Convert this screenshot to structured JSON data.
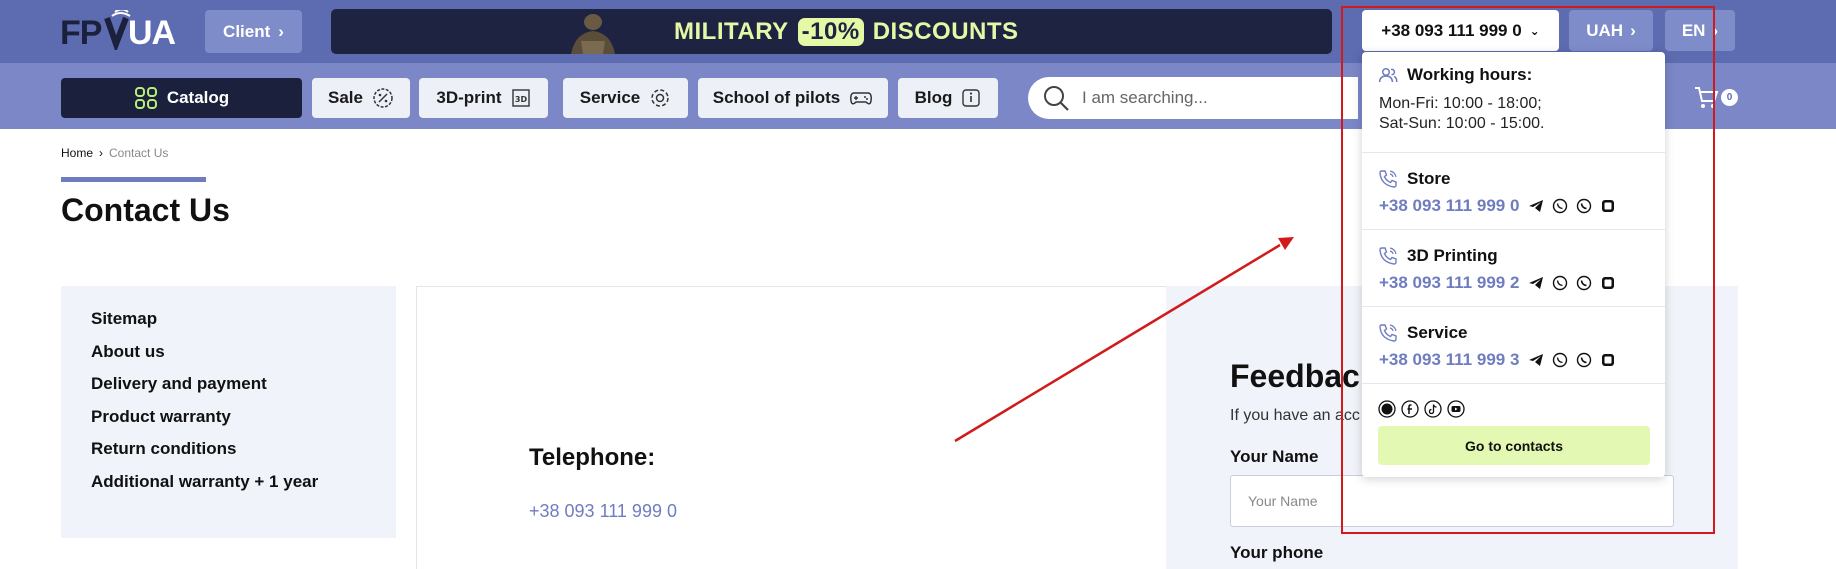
{
  "header": {
    "logo_text": "FPVUA",
    "client_label": "Client",
    "promo": {
      "word1": "MILITARY",
      "badge": "-10%",
      "word2": "DISCOUNTS"
    },
    "phone": "+38 093 111 999 0",
    "currency": "UAH",
    "language": "EN"
  },
  "nav": {
    "catalog": "Catalog",
    "items": [
      "Sale",
      "3D-print",
      "Service",
      "School of pilots",
      "Blog"
    ],
    "search_placeholder": "I am searching...",
    "cart_count": "0"
  },
  "breadcrumb": {
    "home": "Home",
    "separator": "›",
    "current": "Contact Us"
  },
  "page": {
    "title": "Contact Us"
  },
  "sidebar": {
    "items": [
      "Sitemap",
      "About us",
      "Delivery and payment",
      "Product warranty",
      "Return conditions",
      "Additional warranty + 1 year"
    ]
  },
  "contact": {
    "telephone_label": "Telephone:",
    "telephone_value": "+38 093 111 999 0"
  },
  "feedback": {
    "title": "Feedback",
    "subtitle": "If you have an acc",
    "name_label": "Your Name",
    "name_placeholder": "Your Name",
    "phone_label": "Your phone"
  },
  "dropdown": {
    "working_hours_title": "Working hours:",
    "hours_weekdays": "Mon-Fri: 10:00 - 18:00;",
    "hours_weekend": "Sat-Sun: 10:00 - 15:00.",
    "departments": [
      {
        "name": "Store",
        "phone": "+38 093 111 999 0"
      },
      {
        "name": "3D Printing",
        "phone": "+38 093 111 999 2"
      },
      {
        "name": "Service",
        "phone": "+38 093 111 999 3"
      }
    ],
    "goto_label": "Go to contacts"
  },
  "colors": {
    "topbar": "#5d6bb0",
    "navbar": "#7b87c6",
    "accent": "#6f7dc0",
    "promo_bg": "#1f2342",
    "promo_text": "#e4f8a6",
    "highlight": "#d11b1b"
  }
}
